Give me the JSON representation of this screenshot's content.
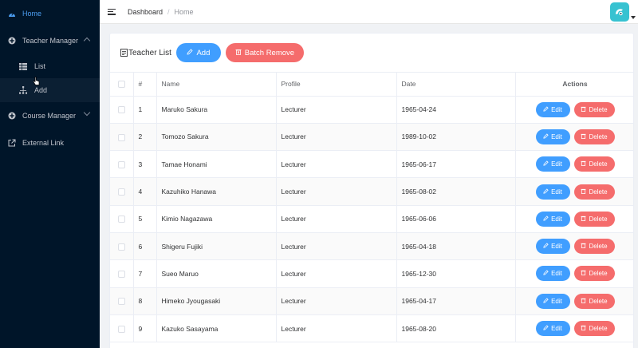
{
  "sidebar": {
    "home": "Home",
    "teacher_manager": "Teacher Manager",
    "list": "List",
    "add": "Add",
    "course_manager": "Course Manager",
    "external_link": "External Link"
  },
  "navbar": {
    "crumb_dashboard": "Dashboard",
    "crumb_separator": "/",
    "crumb_home": "Home"
  },
  "card": {
    "title": "Teacher List",
    "add_label": "Add",
    "batch_remove_label": "Batch Remove"
  },
  "table": {
    "headers": {
      "index": "#",
      "name": "Name",
      "profile": "Profile",
      "date": "Date",
      "actions": "Actions"
    },
    "edit_label": "Edit",
    "delete_label": "Delete",
    "rows": [
      {
        "index": "1",
        "name": "Maruko Sakura",
        "profile": "Lecturer",
        "date": "1965-04-24"
      },
      {
        "index": "2",
        "name": "Tomozo Sakura",
        "profile": "Lecturer",
        "date": "1989-10-02"
      },
      {
        "index": "3",
        "name": "Tamae Honami",
        "profile": "Lecturer",
        "date": "1965-06-17"
      },
      {
        "index": "4",
        "name": "Kazuhiko Hanawa",
        "profile": "Lecturer",
        "date": "1965-08-02"
      },
      {
        "index": "5",
        "name": "Kimio Nagazawa",
        "profile": "Lecturer",
        "date": "1965-06-06"
      },
      {
        "index": "6",
        "name": "Shigeru Fujiki",
        "profile": "Lecturer",
        "date": "1965-04-18"
      },
      {
        "index": "7",
        "name": "Sueo Maruo",
        "profile": "Lecturer",
        "date": "1965-12-30"
      },
      {
        "index": "8",
        "name": "Himeko Jyougasaki",
        "profile": "Lecturer",
        "date": "1965-04-17"
      },
      {
        "index": "9",
        "name": "Kazuko Sasayama",
        "profile": "Lecturer",
        "date": "1965-08-20"
      }
    ]
  },
  "colors": {
    "primary": "#409eff",
    "danger": "#f56c6c",
    "sidebar_bg": "#001529",
    "active": "#4c9ff2",
    "avatar": "#37c2d1"
  },
  "icons": [
    "dashboard-icon",
    "plus-circle-icon",
    "grid-icon",
    "tree-icon",
    "external-link-icon",
    "menu-icon",
    "document-icon",
    "edit-icon",
    "trash-icon"
  ]
}
